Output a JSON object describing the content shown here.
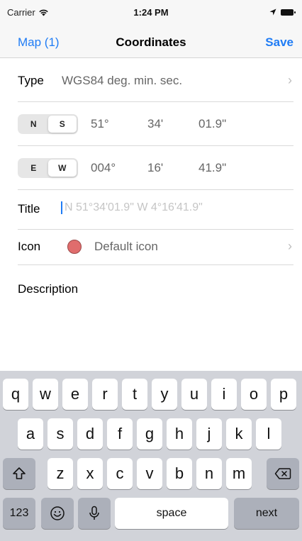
{
  "status_bar": {
    "carrier": "Carrier",
    "time": "1:24 PM"
  },
  "nav": {
    "back_label": "Map (1)",
    "title": "Coordinates",
    "save_label": "Save"
  },
  "type_row": {
    "label": "Type",
    "value": "WGS84 deg. min. sec."
  },
  "lat_row": {
    "options": [
      "N",
      "S"
    ],
    "selected": "S",
    "degrees": "51°",
    "minutes": "34'",
    "seconds": "01.9\""
  },
  "lon_row": {
    "options": [
      "E",
      "W"
    ],
    "selected": "W",
    "degrees": "004°",
    "minutes": "16'",
    "seconds": "41.9\""
  },
  "title_row": {
    "label": "Title",
    "placeholder": "N 51°34'01.9\"  W 4°16'41.9\""
  },
  "icon_row": {
    "label": "Icon",
    "value": "Default icon",
    "icon_color": "#e06d6d"
  },
  "description_row": {
    "label": "Description"
  },
  "keyboard": {
    "row1": [
      "q",
      "w",
      "e",
      "r",
      "t",
      "y",
      "u",
      "i",
      "o",
      "p"
    ],
    "row2": [
      "a",
      "s",
      "d",
      "f",
      "g",
      "h",
      "j",
      "k",
      "l"
    ],
    "row3": [
      "z",
      "x",
      "c",
      "v",
      "b",
      "n",
      "m"
    ],
    "numbers_label": "123",
    "space_label": "space",
    "next_label": "next"
  },
  "colors": {
    "accent": "#1f7cf5",
    "nav_bg": "#f7f7f7",
    "keyboard_bg": "#d1d3d9"
  }
}
